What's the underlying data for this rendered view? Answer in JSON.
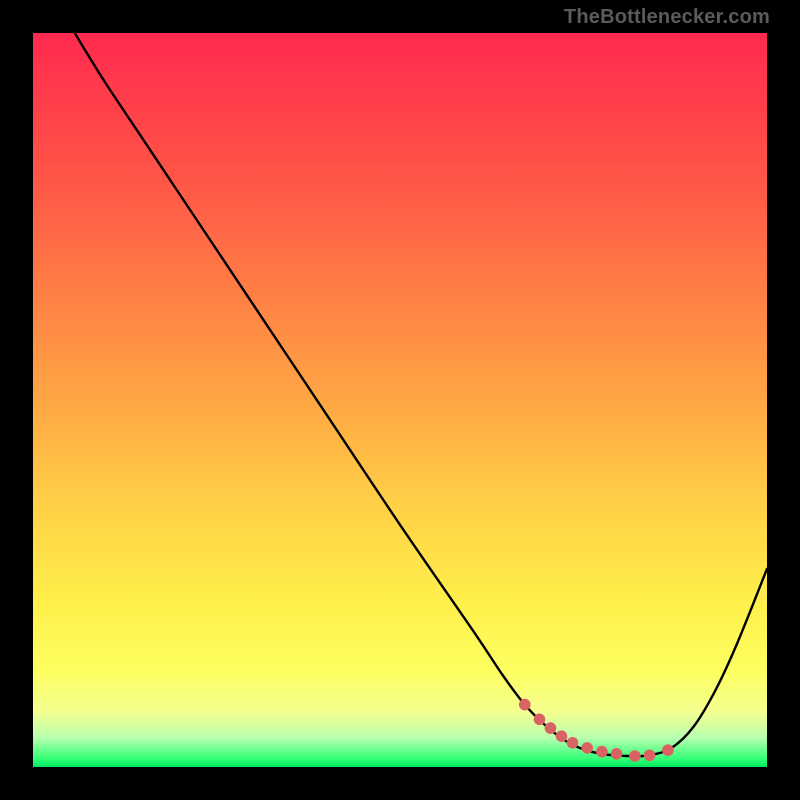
{
  "watermark": "TheBottlenecker.com",
  "chart_data": {
    "type": "line",
    "title": "",
    "xlabel": "",
    "ylabel": "",
    "xlim": [
      0,
      100
    ],
    "ylim": [
      0,
      100
    ],
    "series": [
      {
        "name": "curve",
        "stroke": "#000000",
        "x": [
          5.7,
          7.5,
          10,
          15,
          20,
          30,
          40,
          50,
          60,
          64,
          67,
          70,
          73,
          76,
          79,
          82,
          84,
          87,
          90,
          93,
          96,
          100
        ],
        "y": [
          100,
          97,
          93,
          85.5,
          78,
          63,
          48,
          33,
          18.5,
          12.5,
          8.5,
          5.5,
          3.3,
          2.1,
          1.6,
          1.5,
          1.6,
          2.6,
          5.5,
          10.5,
          17,
          27
        ]
      }
    ],
    "markers": {
      "name": "highlight-points",
      "color": "#d96363",
      "x": [
        67,
        69,
        70.5,
        72,
        73.5,
        75.5,
        77.5,
        79.5,
        82,
        84,
        86.5
      ],
      "y": [
        8.5,
        6.5,
        5.3,
        4.2,
        3.3,
        2.6,
        2.1,
        1.8,
        1.5,
        1.6,
        2.3
      ]
    }
  }
}
